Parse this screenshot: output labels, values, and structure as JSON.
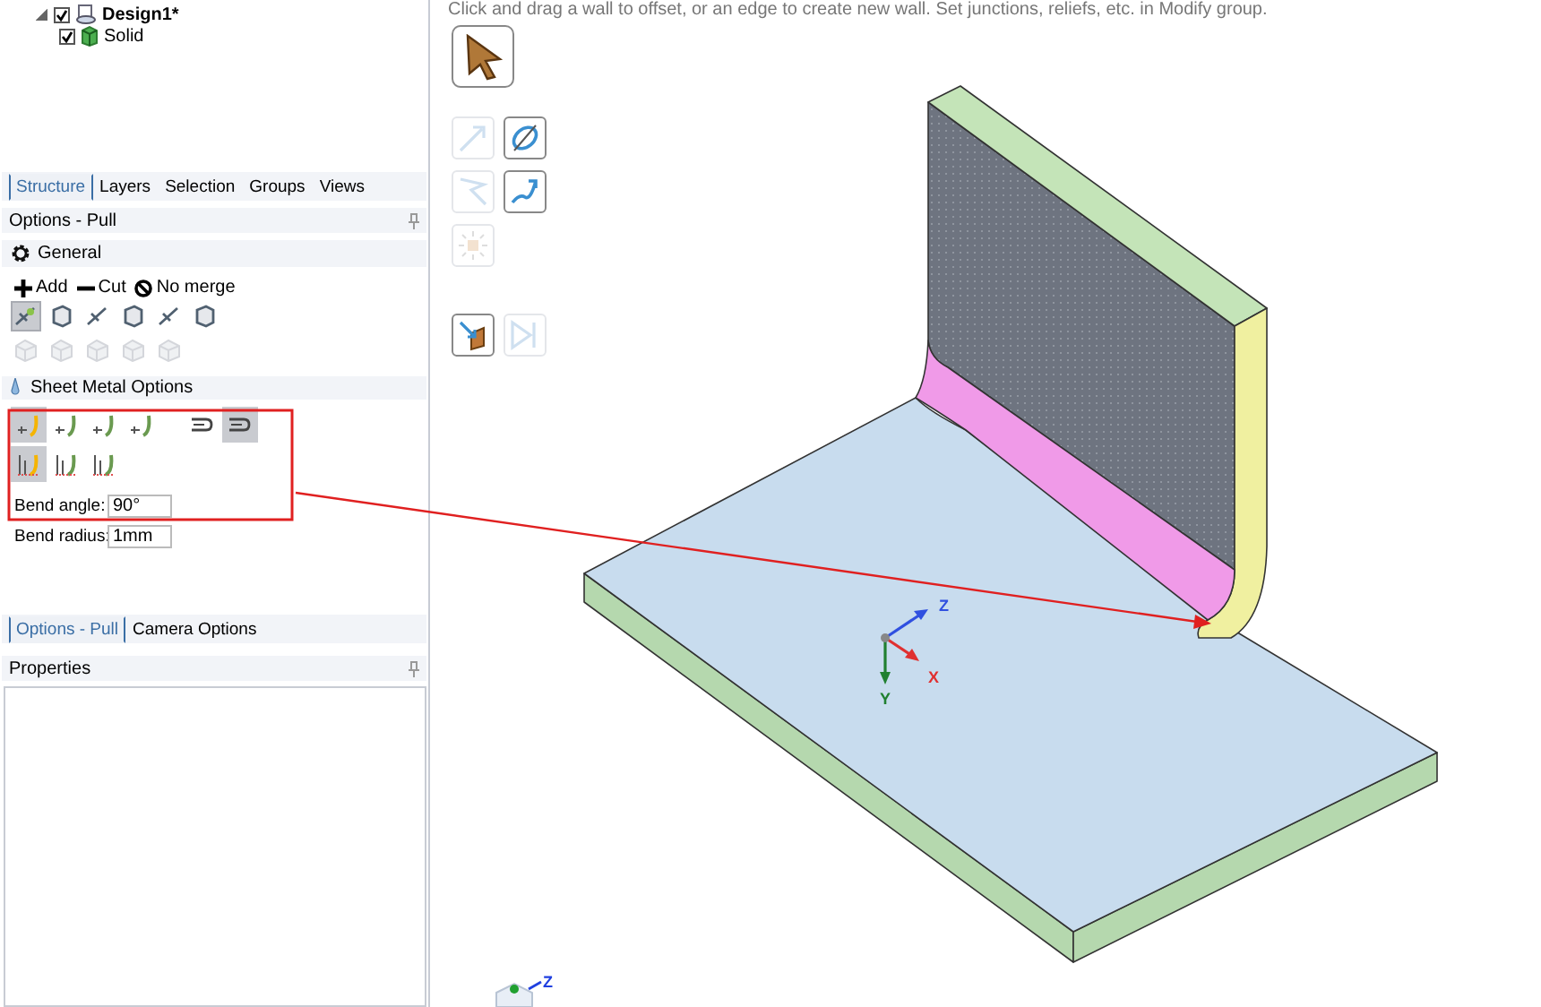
{
  "tree": [
    {
      "label": "Design1*",
      "checked": true,
      "expanded": true,
      "children": [
        {
          "label": "Solid",
          "checked": true
        }
      ]
    }
  ],
  "panel_tabs": [
    {
      "label": "Structure",
      "selected": true
    },
    {
      "label": "Layers",
      "selected": false
    },
    {
      "label": "Selection",
      "selected": false
    },
    {
      "label": "Groups",
      "selected": false
    },
    {
      "label": "Views",
      "selected": false
    }
  ],
  "options": {
    "title": "Options - Pull",
    "section": "General",
    "modes": [
      {
        "kind": "add",
        "label": "Add"
      },
      {
        "kind": "cut",
        "label": "Cut"
      },
      {
        "kind": "no_merge",
        "label": "No merge"
      }
    ],
    "tool_rows": [
      [
        {
          "selected": true,
          "disabled": false
        },
        {
          "selected": false,
          "disabled": false
        },
        {
          "selected": false,
          "disabled": false
        },
        {
          "selected": false,
          "disabled": false
        },
        {
          "selected": false,
          "disabled": false
        },
        {
          "selected": false,
          "disabled": false
        }
      ],
      [
        {
          "selected": false,
          "disabled": true
        },
        {
          "selected": false,
          "disabled": true
        },
        {
          "selected": false,
          "disabled": true
        },
        {
          "selected": false,
          "disabled": true
        },
        {
          "selected": false,
          "disabled": true
        }
      ]
    ],
    "sheet_metal": {
      "title": "Sheet Metal Options",
      "rows": [
        [
          {
            "kind": "bend",
            "selected": true
          },
          {
            "kind": "bend",
            "selected": false
          },
          {
            "kind": "bend",
            "selected": false
          },
          {
            "kind": "bend",
            "selected": false
          },
          {
            "kind": "hem",
            "selected": false
          },
          {
            "kind": "hem",
            "selected": true
          }
        ],
        [
          {
            "kind": "relief",
            "selected": true
          },
          {
            "kind": "relief",
            "selected": false
          },
          {
            "kind": "relief",
            "selected": false
          }
        ]
      ]
    },
    "fields": [
      {
        "label": "Bend angle:",
        "value": "90°"
      },
      {
        "label": "Bend radius:",
        "value": "1mm"
      }
    ]
  },
  "bottom_tabs": [
    {
      "label": "Options - Pull",
      "selected": true
    },
    {
      "label": "Camera Options",
      "selected": false
    }
  ],
  "properties": {
    "title": "Properties"
  },
  "canvas": {
    "hint": "Click and drag a wall to offset, or an edge to create new wall.  Set junctions, reliefs, etc. in Modify group.",
    "tools": [
      [
        {
          "kind": "select",
          "disabled": false
        }
      ],
      [
        {
          "kind": "pull",
          "disabled": true
        },
        {
          "kind": "revolve",
          "disabled": false
        }
      ],
      [
        {
          "kind": "sweep_angle",
          "disabled": true
        },
        {
          "kind": "sweep",
          "disabled": false
        }
      ],
      [
        {
          "kind": "explode",
          "disabled": true
        }
      ],
      [
        {
          "kind": "blend",
          "disabled": false
        },
        {
          "kind": "up_to",
          "disabled": true
        }
      ]
    ],
    "triad": {
      "z": "Z",
      "x": "X",
      "y": "Y"
    },
    "view_cube": {
      "z": "Z"
    },
    "annotation": {
      "kind": "highlight_arrow"
    }
  }
}
